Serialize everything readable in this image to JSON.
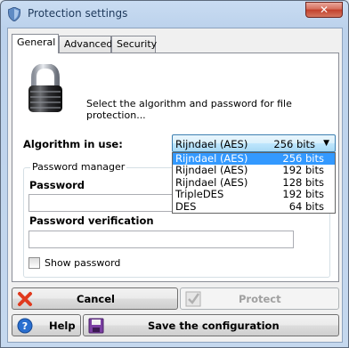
{
  "window": {
    "title": "Protection settings",
    "close_label": "✕"
  },
  "tabs": [
    {
      "label": "General",
      "active": true
    },
    {
      "label": "Advanced",
      "active": false
    },
    {
      "label": "Security",
      "active": false
    }
  ],
  "general": {
    "description": "Select the algorithm and password for file protection...",
    "algorithm_label": "Algorithm in use:",
    "algorithm_selected": {
      "name": "Rijndael (AES)",
      "bits": "256 bits"
    },
    "algorithm_options": [
      {
        "name": "Rijndael (AES)",
        "bits": "256 bits",
        "highlighted": true
      },
      {
        "name": "Rijndael (AES)",
        "bits": "192 bits",
        "highlighted": false
      },
      {
        "name": "Rijndael (AES)",
        "bits": "128 bits",
        "highlighted": false
      },
      {
        "name": "TripleDES",
        "bits": "192 bits",
        "highlighted": false
      },
      {
        "name": "DES",
        "bits": "64 bits",
        "highlighted": false
      }
    ],
    "password_manager": {
      "group_title": "Password manager",
      "password_label": "Password",
      "password_value": "",
      "verification_label": "Password verification",
      "verification_value": "",
      "show_password_label": "Show password",
      "show_password_checked": false
    }
  },
  "buttons": {
    "cancel": "Cancel",
    "protect": "Protect",
    "help": "Help",
    "save": "Save the configuration"
  },
  "colors": {
    "selection_highlight": "#3399ff",
    "cancel_icon": "#e03a1e",
    "help_icon": "#2a6fd0",
    "save_icon": "#7b3fa3",
    "protect_icon_disabled": "#b0b0b0"
  },
  "icons": {
    "app": "shield-icon",
    "lock": "padlock-icon",
    "cancel": "red-x-icon",
    "protect": "checkmark-icon",
    "help": "help-icon",
    "save": "floppy-disk-icon"
  }
}
